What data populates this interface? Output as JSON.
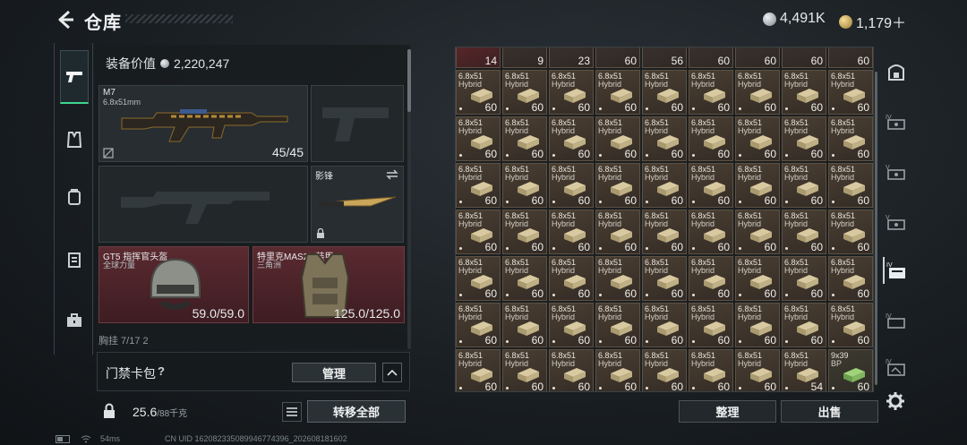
{
  "header": {
    "title": "仓库",
    "currencies": [
      {
        "icon": "silver-coin-icon",
        "value": "4,491K"
      },
      {
        "icon": "gold-coin-icon",
        "value": "1,179＋"
      }
    ]
  },
  "left_nav": [
    "gun-icon",
    "vest-icon",
    "backpack-icon",
    "pouch-icon",
    "briefcase-icon"
  ],
  "loadout": {
    "equip_value_label": "装备价值",
    "equip_value": "2,220,247",
    "primary": {
      "name": "M7",
      "caliber": "6.8x51mm",
      "ammo": "45/45"
    },
    "melee": {
      "name": "影锋"
    },
    "helmet": {
      "name": "GT5 指挥官头盔",
      "sub": "全球力量",
      "durability": "59.0/59.0"
    },
    "armor": {
      "name": "特里克MAS2.0装甲",
      "sub": "三角洲",
      "durability": "125.0/125.0"
    },
    "partial_row": "胸挂  7/17  2"
  },
  "access_card": {
    "label": "门禁卡包",
    "help": "?",
    "manage": "管理"
  },
  "weight": {
    "current": "25.6",
    "max": "/88千克",
    "transfer": "转移全部"
  },
  "grid": {
    "top_row": [
      "14",
      "9",
      "23",
      "60",
      "56",
      "60",
      "60",
      "60",
      "60"
    ],
    "ammo_name_l1": "6.8x51",
    "ammo_name_l2": "Hybrid",
    "default_qty": "60",
    "odd_cells": [
      {
        "row": 7,
        "col": 7,
        "qty": "54"
      },
      {
        "row": 7,
        "col": 8,
        "l1": "9x39",
        "l2": "BP",
        "qty": "60",
        "green": true
      }
    ]
  },
  "buttons": {
    "sort": "整理",
    "sell": "出售"
  },
  "right_nav": [
    "safe-icon",
    "case-iv-icon",
    "case-v-icon",
    "case-v2-icon",
    "case-iv-active-icon",
    "case-iv-2-icon",
    "case-iv-3-icon"
  ],
  "status": {
    "ping": "54ms",
    "uid": "CN UID 16208233508994677439​6_202608181602"
  },
  "colors": {
    "accent_green": "#3fd58f",
    "panel_red": "#5a2a30"
  }
}
